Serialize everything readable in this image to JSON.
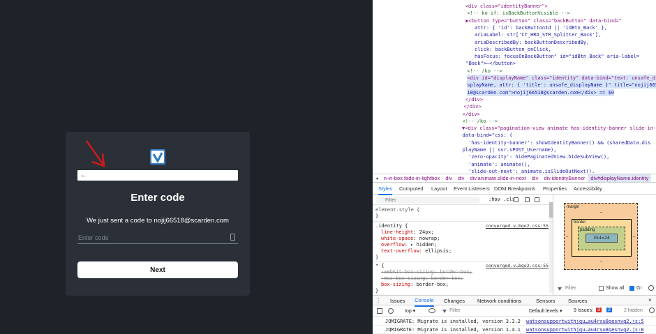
{
  "signin": {
    "title": "Enter code",
    "message": "We just sent a code to nojij66518@scarden.com",
    "code_placeholder": "Enter code",
    "next_label": "Next",
    "back_glyph": "←",
    "logo_icon": "check-shield-icon",
    "arrow_color": "#d11a1a"
  },
  "devtools": {
    "html_lines": [
      {
        "indent": 16,
        "html": "<span class='tag'>&lt;div</span> <span class='attr'>class</span>=<span class='val'>\"identityBanner\"</span><span class='tag'>&gt;</span>",
        "text": "<div class=\"identityBanner\">"
      },
      {
        "indent": 24,
        "text": "<!-- ko if: isBackButtonVisible -->"
      },
      {
        "indent": 18,
        "text": "▶<button type=\"button\" class=\"backButton\" data-bind=\""
      },
      {
        "indent": 60,
        "text": "attr: { 'id': backButtonId || 'idBtn_Back' },"
      },
      {
        "indent": 60,
        "text": "ariaLabel: str['CT_HRD_STR_Splitter_Back'],"
      },
      {
        "indent": 60,
        "text": "ariaDescribedBy: backButtonDescribedBy,"
      },
      {
        "indent": 60,
        "text": "click: backButton_onClick,"
      },
      {
        "indent": 60,
        "text": "hasFocus: focusOnBackButton\" id=\"idBtn_Back\" aria-label="
      },
      {
        "indent": 18,
        "text": "\"Back\">⋯</button>"
      },
      {
        "indent": 24,
        "text": "<!-- /ko -->"
      },
      {
        "indent": 24,
        "text": "<div id=\"displayName\" class=\"identity\" data-bind=\"text: unsafe_di"
      },
      {
        "indent": 24,
        "text": "splayName, attr: { 'title': unsafe_displayName }\" title=\"nojij665"
      },
      {
        "indent": 24,
        "text": "18@scarden.com\">nojij66518@scarden.com</div> == $0"
      },
      {
        "indent": 16,
        "text": "</div>"
      },
      {
        "indent": 8,
        "text": "</div>"
      },
      {
        "indent": 2,
        "text": "</div>"
      },
      {
        "indent": 2,
        "text": "<!-- /ko -->"
      },
      {
        "indent": 0,
        "text": "▼<div class=\"pagination-view animate has-identity-banner slide-in-next\""
      },
      {
        "indent": 2,
        "text": "data-bind=\"css: {"
      },
      {
        "indent": 30,
        "text": "'has-identity-banner': showIdentityBanner() && (sharedData.dis"
      },
      {
        "indent": 2,
        "text": "playName || svr.sPOST_Username),"
      },
      {
        "indent": 30,
        "text": "'zero-opacity': hidePaginatedView.hideSubView(),"
      },
      {
        "indent": 30,
        "text": "'animate': animate(),"
      },
      {
        "indent": 30,
        "text": "'slide-out-next': animate.isSlideOutNext(),"
      }
    ],
    "breadcrumbs": [
      "n-in-box.fade-in-lightbox",
      "div",
      "div",
      "div.animate.slide-in-next",
      "div",
      "div.identityBanner",
      "div#displayName.identity"
    ],
    "panel_tabs": [
      "Styles",
      "Computed",
      "Layout",
      "Event Listeners",
      "DOM Breakpoints",
      "Properties",
      "Accessibility"
    ],
    "filter_placeholder": "Filter",
    "hov_cls": ":hov .cls",
    "rules": {
      "element_style": "element.style {",
      "close": "}",
      "identity_selector": ".identity {",
      "identity_src": "converged.v…bgo2.css:55",
      "identity_props": [
        {
          "name": "line-height",
          "value": "24px;"
        },
        {
          "name": "white-space",
          "value": "nowrap;"
        },
        {
          "name": "overflow",
          "value": "▸ hidden;"
        },
        {
          "name": "text-overflow",
          "value": "ellipsis;"
        }
      ],
      "star_selector": "* {",
      "star_src": "converged.v…bgo2.css:55",
      "star_props": [
        {
          "name": "-webkit-box-sizing",
          "value": "border-box;",
          "struck": true
        },
        {
          "name": "-moz-box-sizing",
          "value": "border-box;",
          "struck": true
        },
        {
          "name": "box-sizing",
          "value": "border-box;",
          "struck": false
        }
      ]
    },
    "boxmodel": {
      "margin_label": "margin",
      "border_label": "border",
      "padding_label": "padding",
      "content": "354×24",
      "dash": "–"
    },
    "computed": {
      "filter_placeholder": "Filter",
      "show_all": "Show all",
      "group": "Gr"
    },
    "drawer_tabs": [
      "Issues",
      "Changes",
      "Network conditions",
      "Sensors",
      "Sources"
    ],
    "drawer_active": "Console",
    "console": {
      "context": "top ▾",
      "filter_placeholder": "Filter",
      "levels": "Default levels ▾",
      "issues": "9 Issues:",
      "issue_counts": [
        "3",
        "2"
      ],
      "hidden": "2 hidden",
      "messages": [
        {
          "text": "JQMIGRATE: Migrate is installed, version 3.3.2",
          "link": "watsonsupportwithjqu…au4rsu8gesnvg2.js:5"
        },
        {
          "text": "JQMIGRATE: Migrate is installed, version 1.4.1",
          "link": "watsonsupportwithjqu…au4rsu8gesnvg2.js:8"
        }
      ]
    }
  }
}
